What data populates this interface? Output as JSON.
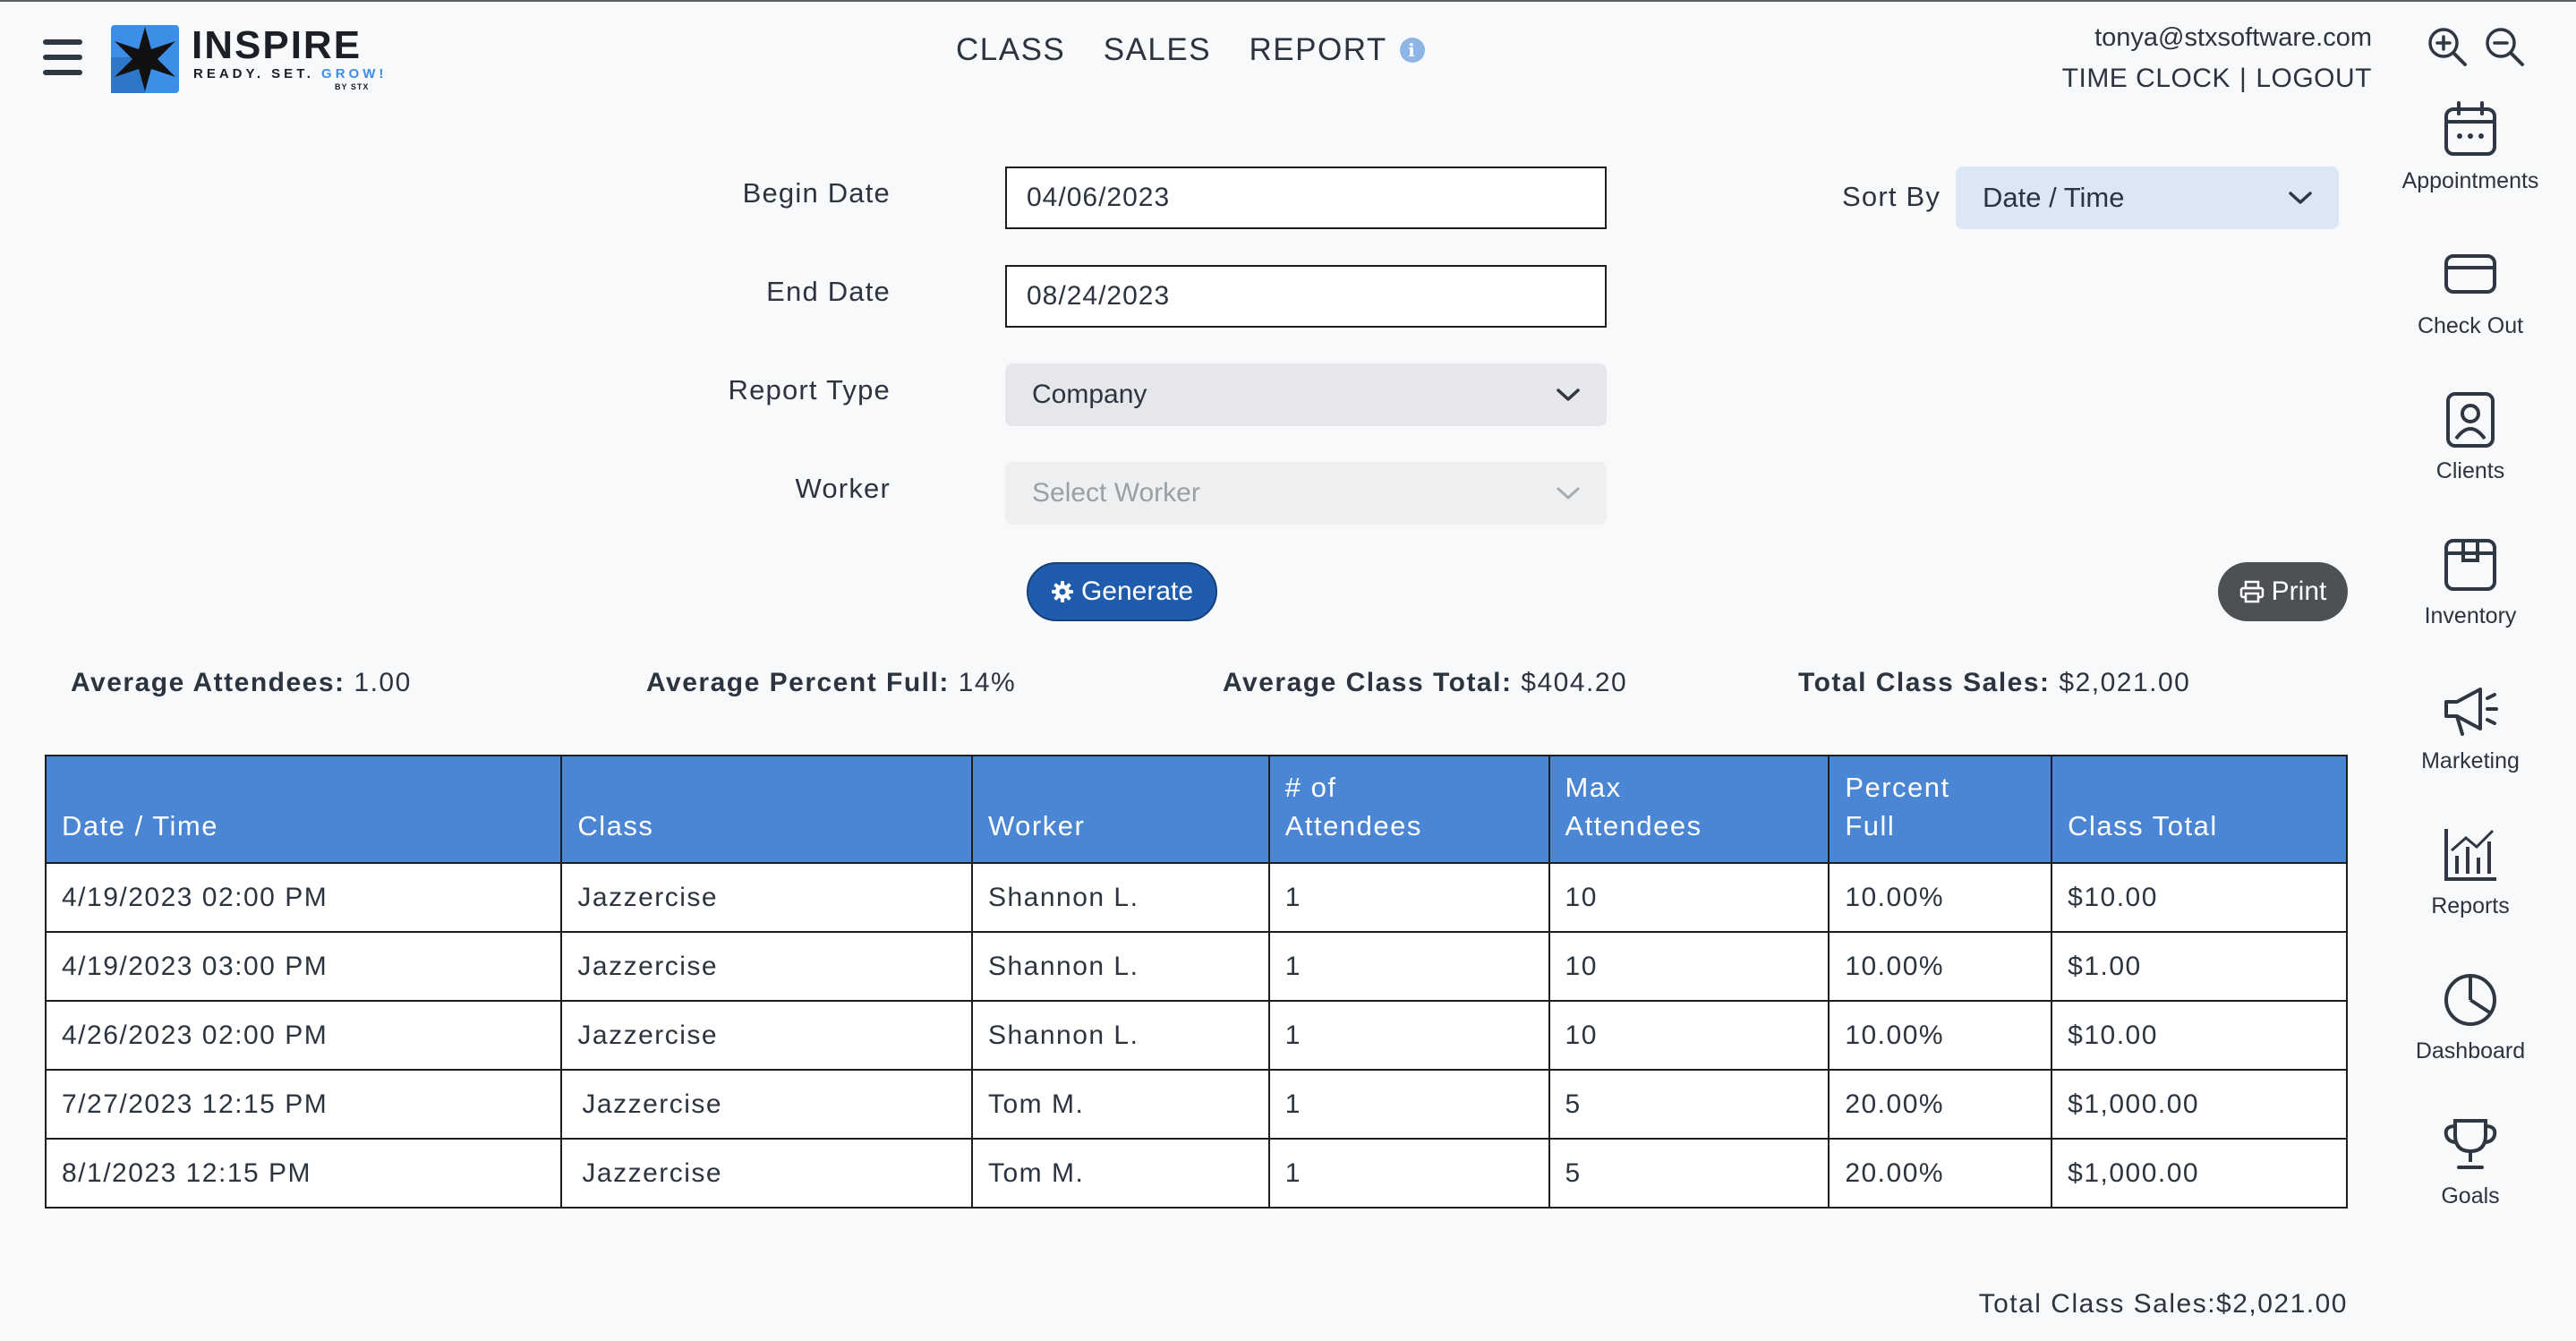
{
  "header": {
    "logo_title": "INSPIRE",
    "logo_tag_a": "READY. SET.",
    "logo_tag_b": "GROW!",
    "logo_by": "BY STX",
    "page_title": "CLASS  SALES  REPORT",
    "info_glyph": "i",
    "user_email": "tonya@stxsoftware.com",
    "time_clock": "TIME CLOCK",
    "separator": "|",
    "logout": "LOGOUT"
  },
  "icons": {
    "menu": "hamburger-icon",
    "zoom_in": "zoom-in-icon",
    "zoom_out": "zoom-out-icon",
    "info": "info-icon",
    "gear": "gear-icon",
    "printer": "printer-icon",
    "chevron": "chevron-down-icon"
  },
  "nav": [
    {
      "label": "Appointments",
      "icon": "calendar-icon"
    },
    {
      "label": "Check Out",
      "icon": "credit-card-icon"
    },
    {
      "label": "Clients",
      "icon": "client-icon"
    },
    {
      "label": "Inventory",
      "icon": "box-icon"
    },
    {
      "label": "Marketing",
      "icon": "megaphone-icon"
    },
    {
      "label": "Reports",
      "icon": "bar-chart-icon"
    },
    {
      "label": "Dashboard",
      "icon": "pie-chart-icon"
    },
    {
      "label": "Goals",
      "icon": "trophy-icon"
    }
  ],
  "form": {
    "begin_date_label": "Begin Date",
    "begin_date_value": "04/06/2023",
    "end_date_label": "End Date",
    "end_date_value": "08/24/2023",
    "report_type_label": "Report Type",
    "report_type_value": "Company",
    "worker_label": "Worker",
    "worker_placeholder": "Select Worker",
    "sort_by_label": "Sort By",
    "sort_by_value": "Date / Time",
    "generate_label": "Generate",
    "print_label": "Print"
  },
  "stats": {
    "avg_attendees_label": "Average Attendees:",
    "avg_attendees_value": "1.00",
    "avg_percent_label": "Average Percent Full:",
    "avg_percent_value": "14%",
    "avg_class_total_label": "Average Class Total:",
    "avg_class_total_value": "$404.20",
    "total_sales_label": "Total Class Sales:",
    "total_sales_value": "$2,021.00"
  },
  "table": {
    "headers": [
      [
        "Date / Time"
      ],
      [
        "Class"
      ],
      [
        "Worker"
      ],
      [
        "# of",
        "Attendees"
      ],
      [
        "Max",
        "Attendees"
      ],
      [
        "Percent",
        "Full"
      ],
      [
        "Class Total"
      ]
    ],
    "rows": [
      [
        "4/19/2023 02:00 PM",
        "Jazzercise",
        "Shannon L.",
        "1",
        "10",
        "10.00%",
        "$10.00"
      ],
      [
        "4/19/2023 03:00 PM",
        "Jazzercise",
        "Shannon L.",
        "1",
        "10",
        "10.00%",
        "$1.00"
      ],
      [
        "4/26/2023 02:00 PM",
        "Jazzercise",
        "Shannon L.",
        "1",
        "10",
        "10.00%",
        "$10.00"
      ],
      [
        "7/27/2023 12:15 PM",
        "Jazzercise",
        "Tom M.",
        "1",
        "5",
        "20.00%",
        "$1,000.00"
      ],
      [
        "8/1/2023 12:15 PM",
        "Jazzercise",
        "Tom M.",
        "1",
        "5",
        "20.00%",
        "$1,000.00"
      ]
    ]
  },
  "footer": {
    "total_label": "Total Class Sales:",
    "total_value": "$2,021.00"
  },
  "colors": {
    "accent": "#1f5cae",
    "table_header": "#4a86d4",
    "sort_bg": "#dce7f5",
    "logo_blue": "#3d8ee6"
  }
}
